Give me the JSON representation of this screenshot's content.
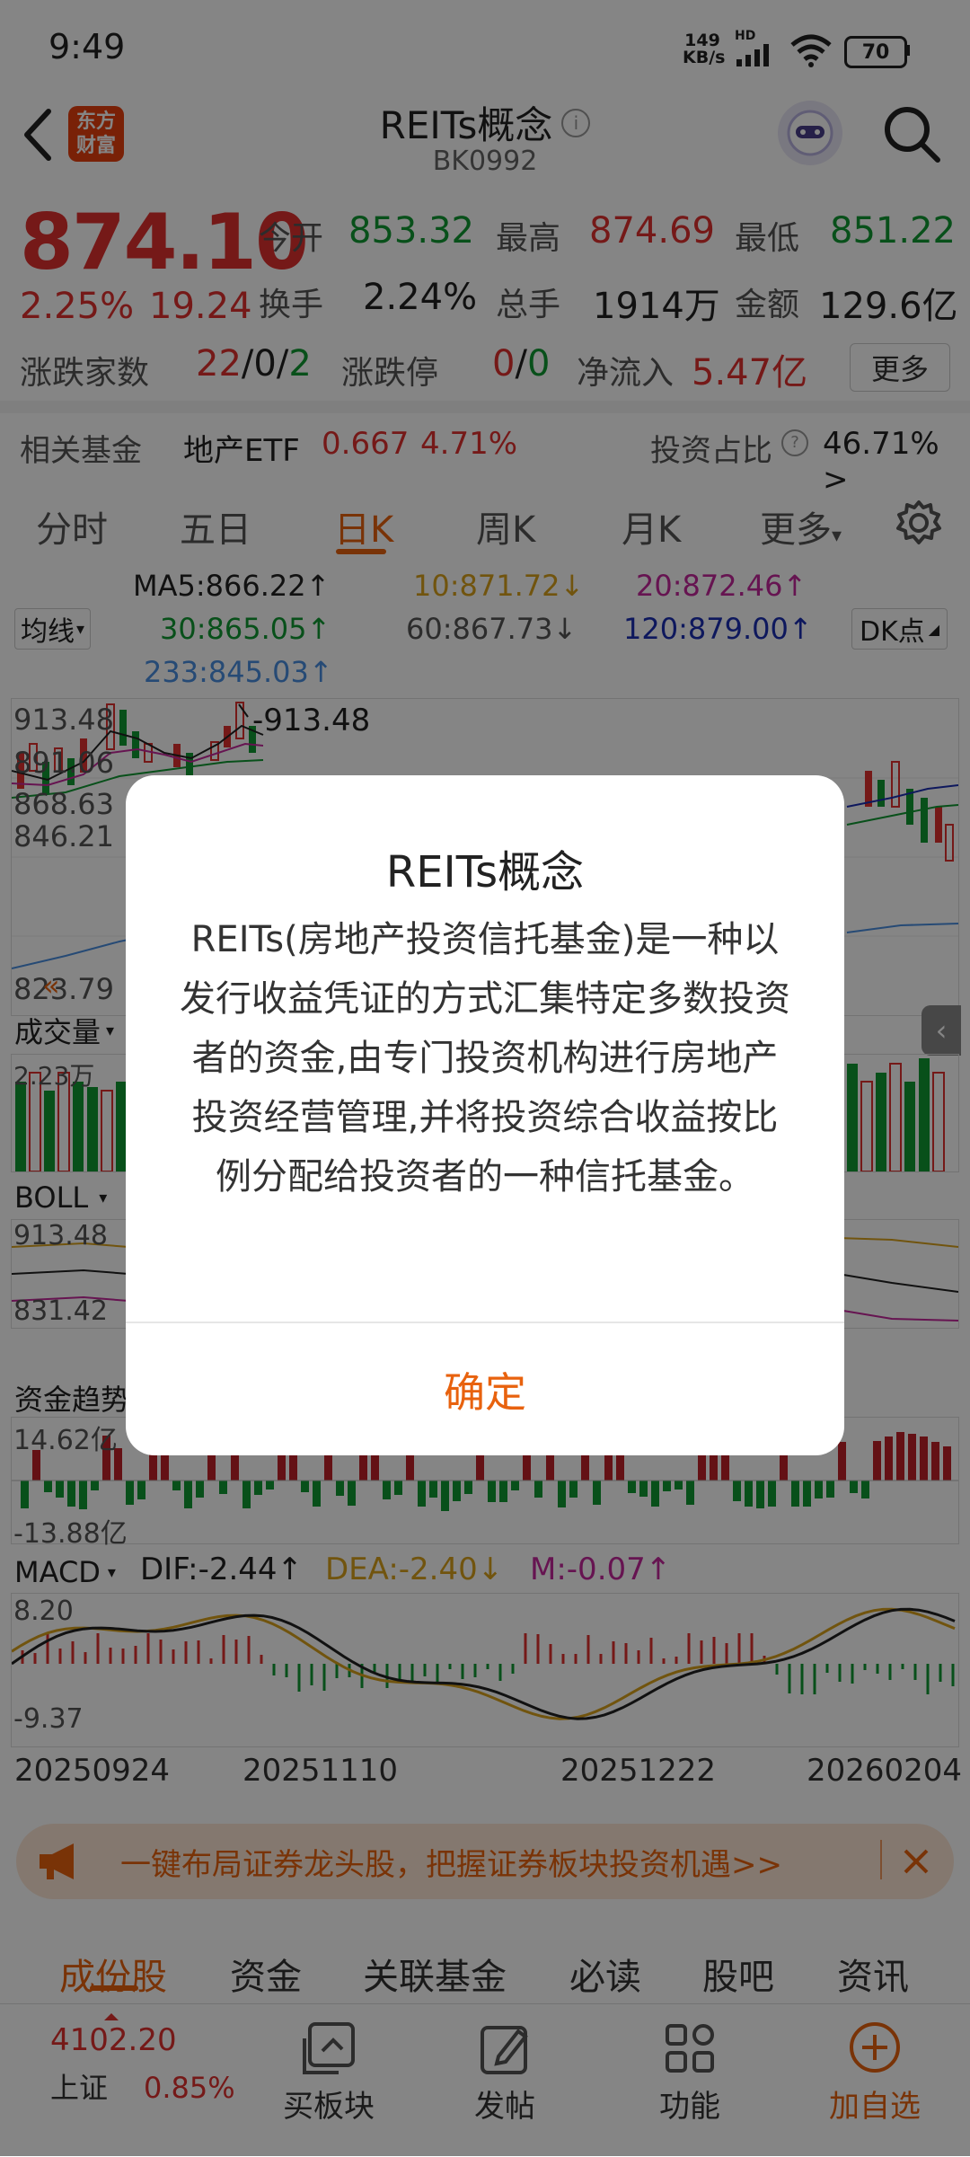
{
  "status": {
    "time": "9:49",
    "net_speed_value": "149",
    "net_speed_unit": "KB/s",
    "hd": "HD",
    "battery": "70"
  },
  "nav": {
    "logo_line1": "东方",
    "logo_line2": "财富",
    "title": "REITs概念",
    "code": "BK0992"
  },
  "quote": {
    "price": "874.10",
    "change_pct": "2.25%",
    "change": "19.24",
    "open_label": "今开",
    "open": "853.32",
    "high_label": "最高",
    "high": "874.69",
    "low_label": "最低",
    "low": "851.22",
    "turnover_label": "换手",
    "turnover": "2.24%",
    "volume_label": "总手",
    "volume": "1914万",
    "amount_label": "金额",
    "amount": "129.6亿",
    "updown_label": "涨跌家数",
    "up": "22",
    "flat": "0",
    "down": "2",
    "limit_label": "涨跌停",
    "limit_up": "0",
    "limit_down": "0",
    "netflow_label": "净流入",
    "netflow": "5.47亿",
    "more": "更多"
  },
  "fund": {
    "label": "相关基金",
    "name": "地产ETF",
    "price": "0.667",
    "pct": "4.71%",
    "ratio_label": "投资占比",
    "ratio": "46.71% >"
  },
  "ktabs": {
    "t1": "分时",
    "t2": "五日",
    "t3": "日K",
    "t4": "周K",
    "t5": "月K",
    "t6": "更多"
  },
  "ma": {
    "selector": "均线",
    "ma5": "MA5:866.22↑",
    "ma10": "10:871.72↓",
    "ma20": "20:872.46↑",
    "ma30": "30:865.05↑",
    "ma60": "60:867.73↓",
    "ma120": "120:879.00↑",
    "ma233": "233:845.03↑",
    "dk": "DK点"
  },
  "kchart": {
    "y1": "913.48",
    "y2": "891.06",
    "y3": "868.63",
    "y4": "846.21",
    "y5": "823.79",
    "max_label": "913.48"
  },
  "vol": {
    "selector": "成交量",
    "y": "2.23万"
  },
  "boll": {
    "selector": "BOLL",
    "y1": "913.48",
    "y2": "831.42"
  },
  "fund_trend": {
    "selector": "资金趋势",
    "top": "14.62亿",
    "bottom": "-13.88亿"
  },
  "macd": {
    "selector": "MACD",
    "dif": "DIF:-2.44↑",
    "dea": "DEA:-2.40↓",
    "m": "M:-0.07↑",
    "top": "8.20",
    "bottom": "-9.37"
  },
  "dates": {
    "d1": "20250924",
    "d2": "20251110",
    "d3": "20251222",
    "d4": "20260204"
  },
  "banner": {
    "text": "一键布局证券龙头股，把握证券板块投资机遇>>"
  },
  "bottom_tabs": {
    "b1": "成份股",
    "b2": "资金",
    "b3": "关联基金",
    "b4": "必读",
    "b5": "股吧",
    "b6": "资讯"
  },
  "footer": {
    "index_value": "4102.20",
    "index_name": "上证",
    "index_pct": "0.85%",
    "buy": "买板块",
    "post": "发帖",
    "func": "功能",
    "add": "加自选"
  },
  "dialog": {
    "title": "REITs概念",
    "body": "REITs(房地产投资信托基金)是一种以发行收益凭证的方式汇集特定多数投资者的资金,由专门投资机构进行房地产投资经营管理,并将投资综合收益按比例分配给投资者的一种信托基金。",
    "confirm": "确定"
  },
  "colors": {
    "accent": "#e8620e",
    "up": "#e0312f",
    "down": "#119933"
  }
}
